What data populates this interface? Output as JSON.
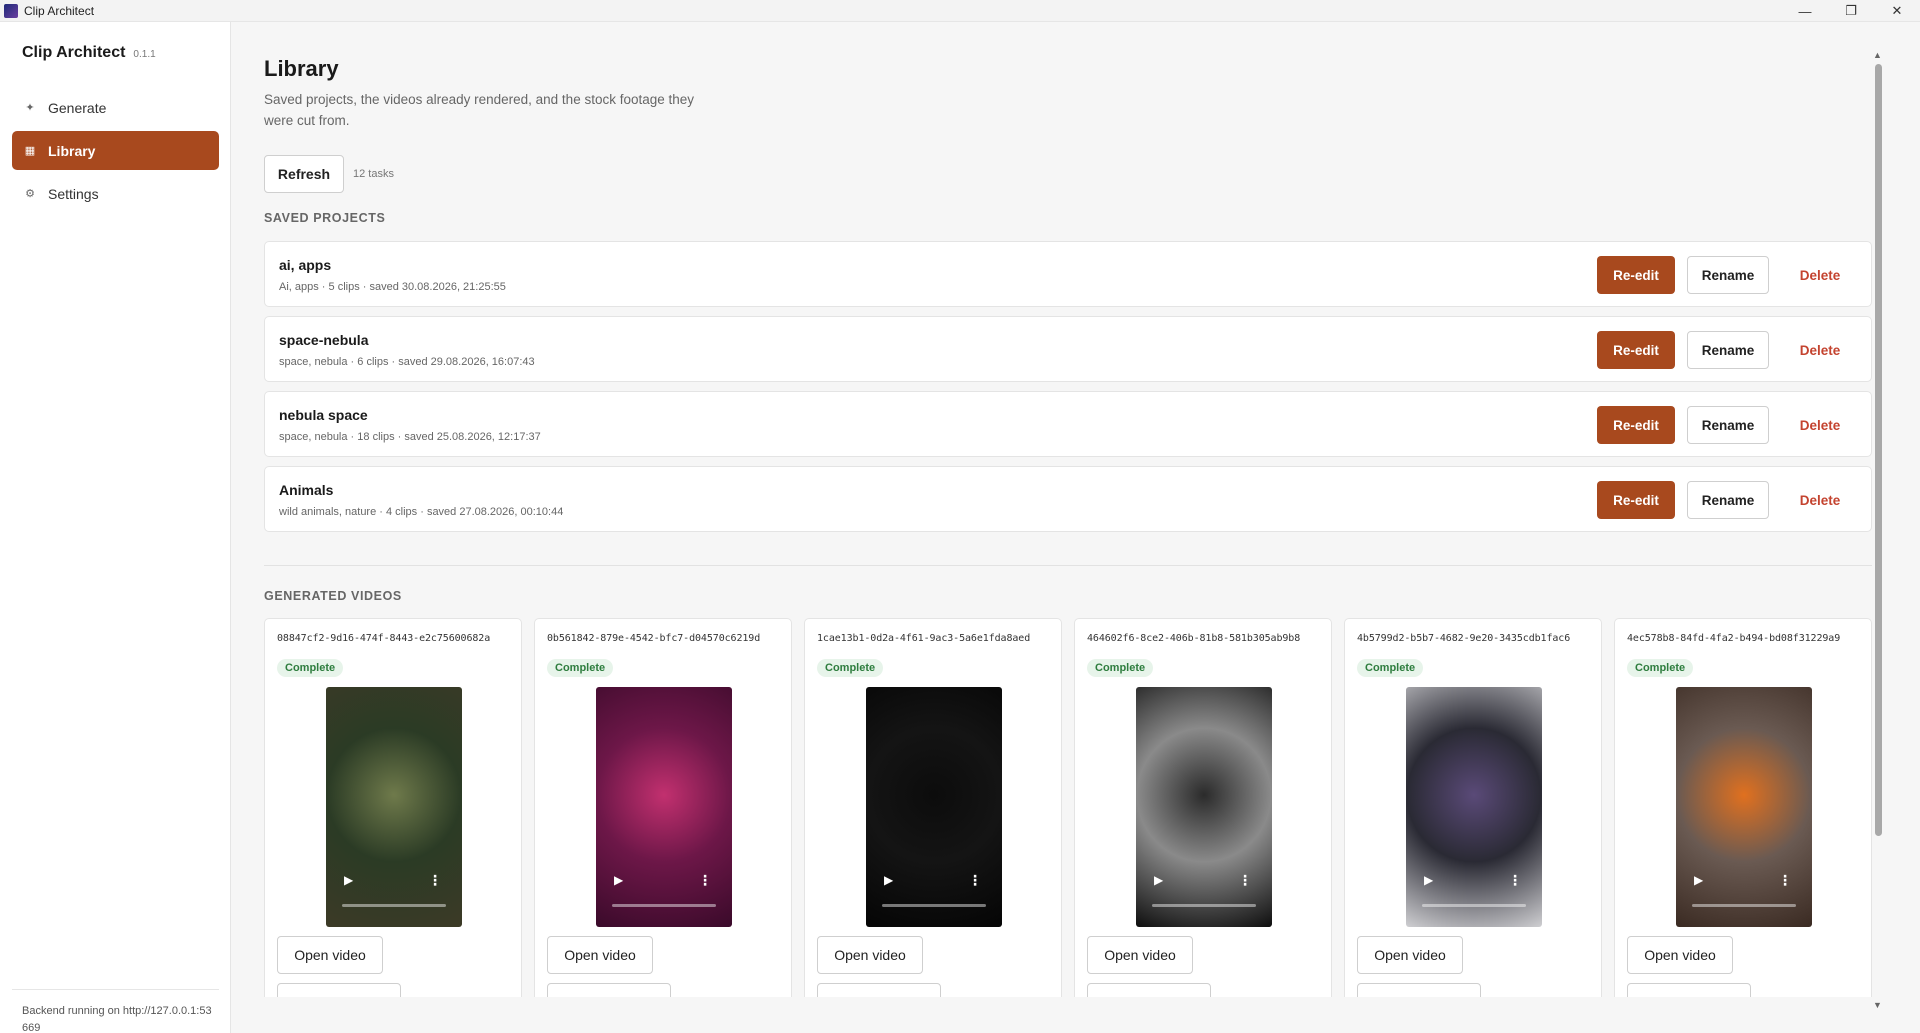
{
  "window": {
    "title": "Clip Architect",
    "controls": {
      "minimize": "—",
      "restore": "❐",
      "close": "✕"
    }
  },
  "sidebar": {
    "brand": "Clip Architect",
    "version": "0.1.1",
    "items": [
      {
        "label": "Generate",
        "icon": "sparkle-icon",
        "glyph": "✦",
        "active": false
      },
      {
        "label": "Library",
        "icon": "grid-icon",
        "glyph": "▦",
        "active": true
      },
      {
        "label": "Settings",
        "icon": "gear-icon",
        "glyph": "⚙",
        "active": false
      }
    ],
    "backend_status": "Backend running on http://127.0.0.1:53669"
  },
  "page": {
    "title": "Library",
    "description": "Saved projects, the videos already rendered, and the stock footage they were cut from.",
    "refresh_label": "Refresh",
    "task_count": "12 tasks"
  },
  "saved_projects": {
    "heading": "SAVED PROJECTS",
    "reedit_label": "Re-edit",
    "rename_label": "Rename",
    "delete_label": "Delete",
    "items": [
      {
        "name": "ai, apps",
        "meta": "Ai, apps · 5 clips · saved 30.08.2026, 21:25:55"
      },
      {
        "name": "space-nebula",
        "meta": "space, nebula · 6 clips · saved 29.08.2026, 16:07:43"
      },
      {
        "name": "nebula space",
        "meta": "space, nebula · 18 clips · saved 25.08.2026, 12:17:37"
      },
      {
        "name": "Animals",
        "meta": "wild animals, nature · 4 clips · saved 27.08.2026, 00:10:44"
      }
    ]
  },
  "generated_videos": {
    "heading": "GENERATED VIDEOS",
    "open_label": "Open video",
    "items": [
      {
        "id": "08847cf2-9d16-474f-8443-e2c75600682a",
        "status": "Complete",
        "thumb_colors": [
          "#3c3a26",
          "#6f7a4b",
          "#2b3b25"
        ]
      },
      {
        "id": "0b561842-879e-4542-bfc7-d04570c6219d",
        "status": "Complete",
        "thumb_colors": [
          "#3a0a2a",
          "#c2306f",
          "#6d1748"
        ]
      },
      {
        "id": "1cae13b1-0d2a-4f61-9ac3-5a6e1fda8aed",
        "status": "Complete",
        "thumb_colors": [
          "#050505",
          "#0c0c0c",
          "#141414"
        ]
      },
      {
        "id": "464602f6-8ce2-406b-81b8-581b305ab9b8",
        "status": "Complete",
        "thumb_colors": [
          "#0e0e0e",
          "#2b2b2b",
          "#8a8a8a"
        ]
      },
      {
        "id": "4b5799d2-b5b7-4682-9e20-3435cdb1fac6",
        "status": "Complete",
        "thumb_colors": [
          "#cfcfd2",
          "#5a4a78",
          "#2a2a34"
        ]
      },
      {
        "id": "4ec578b8-84fd-4fa2-b494-bd08f31229a9",
        "status": "Complete",
        "thumb_colors": [
          "#3a2a22",
          "#e0701f",
          "#6a5a52"
        ]
      }
    ]
  }
}
